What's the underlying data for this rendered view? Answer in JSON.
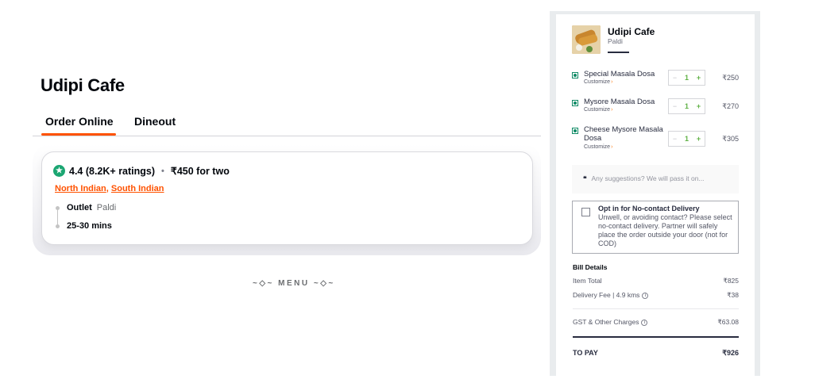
{
  "restaurant": {
    "name": "Udipi Cafe",
    "tabs": [
      "Order Online",
      "Dineout"
    ],
    "rating": "4.4 (8.2K+ ratings)",
    "cost_for_two": "₹450 for two",
    "cuisines": [
      "North Indian",
      "South Indian"
    ],
    "outlet_label": "Outlet",
    "outlet_value": "Paldi",
    "eta": "25-30 mins",
    "menu_label": "MENU",
    "menu_deco": "~◇~"
  },
  "cart": {
    "restaurant_name": "Udipi Cafe",
    "area": "Paldi",
    "items": [
      {
        "name": "Special Masala Dosa",
        "customize": "Customize",
        "qty": "1",
        "price": "₹250"
      },
      {
        "name": "Mysore Masala Dosa",
        "customize": "Customize",
        "qty": "1",
        "price": "₹270"
      },
      {
        "name": "Cheese Mysore Masala Dosa",
        "customize": "Customize",
        "qty": "1",
        "price": "₹305"
      }
    ],
    "stepper_minus": "−",
    "stepper_plus": "+",
    "suggestion_quote": "❝",
    "suggestion_placeholder": "Any suggestions? We will pass it on...",
    "no_contact_title": "Opt in for No-contact Delivery",
    "no_contact_desc": "Unwell, or avoiding contact? Please select no-contact delivery. Partner will safely place the order outside your door (not for COD)",
    "bill": {
      "title": "Bill Details",
      "item_total_label": "Item Total",
      "item_total_value": "₹825",
      "delivery_label": "Delivery Fee | 4.9 kms",
      "delivery_value": "₹38",
      "gst_label": "GST & Other Charges",
      "gst_value": "₹63.08",
      "to_pay_label": "TO PAY",
      "to_pay_value": "₹926",
      "info_glyph": "i"
    }
  },
  "colors": {
    "accent": "#ff5200",
    "veg": "#0f8a65",
    "rating": "#1ba672",
    "stepper": "#60b246"
  }
}
